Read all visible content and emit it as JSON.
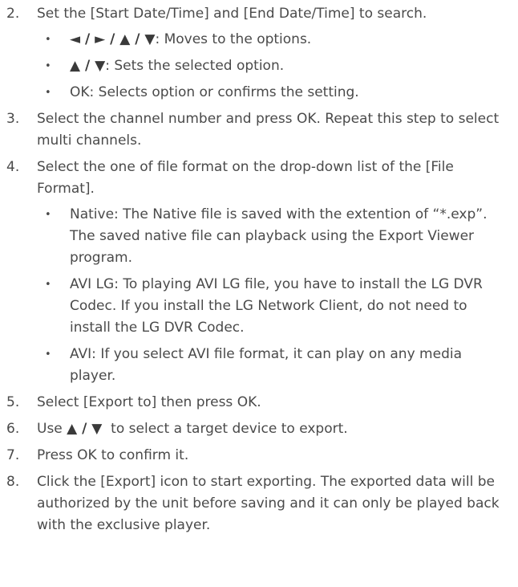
{
  "steps": [
    {
      "num": "2.",
      "text": "Set the [Start Date/Time] and [End Date/Time] to search.",
      "bullets": [
        {
          "sym": "◄ / ► / ▲ / ▼",
          "text": ": Moves to the options."
        },
        {
          "sym": "▲ / ▼",
          "text": ": Sets the selected option."
        },
        {
          "sym": "",
          "text": "OK: Selects option or confirms the setting."
        }
      ]
    },
    {
      "num": "3.",
      "text": "Select the channel number and press OK. Repeat this step to select multi channels."
    },
    {
      "num": "4.",
      "text": "Select the one of file format on the drop-down list of the [File Format].",
      "bullets": [
        {
          "sym": "",
          "text": "Native: The Native file is saved with the extention of “*.exp”. The saved native file can playback using the Export Viewer program."
        },
        {
          "sym": "",
          "text": "AVI LG: To playing AVI LG file, you have to install the LG DVR Codec. If you install the LG Network Client, do not need to install the LG DVR Codec."
        },
        {
          "sym": "",
          "text": "AVI: If you select AVI file format, it can play on any media player."
        }
      ]
    },
    {
      "num": "5.",
      "text": "Select [Export to] then press OK."
    },
    {
      "num": "6.",
      "pre": "Use ",
      "sym": "▲ / ▼",
      "text": "  to select a target device to export."
    },
    {
      "num": "7.",
      "text": "Press OK to confirm it."
    },
    {
      "num": "8.",
      "text": "Click the [Export] icon to start exporting. The exported data will be authorized by the unit before saving and it can only be played back with the exclusive player."
    }
  ],
  "bullet_glyph": "•"
}
